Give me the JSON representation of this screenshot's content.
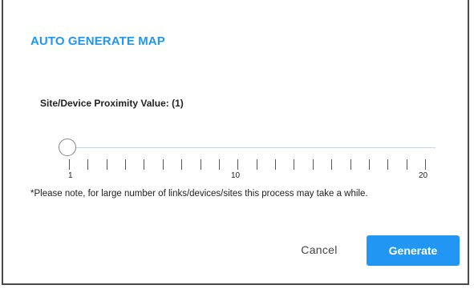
{
  "dialog": {
    "title": "AUTO GENERATE MAP",
    "slider": {
      "label": "Site/Device Proximity Value: (1)",
      "min": 1,
      "max": 20,
      "value": 1,
      "tick_labels": [
        "1",
        "10",
        "20"
      ]
    },
    "note": "*Please note, for large number of links/devices/sites this process may take a while.",
    "buttons": {
      "cancel_label": "Cancel",
      "generate_label": "Generate"
    }
  },
  "colors": {
    "accent": "#2196f3",
    "text": "#222222",
    "track": "#c9d4df"
  }
}
